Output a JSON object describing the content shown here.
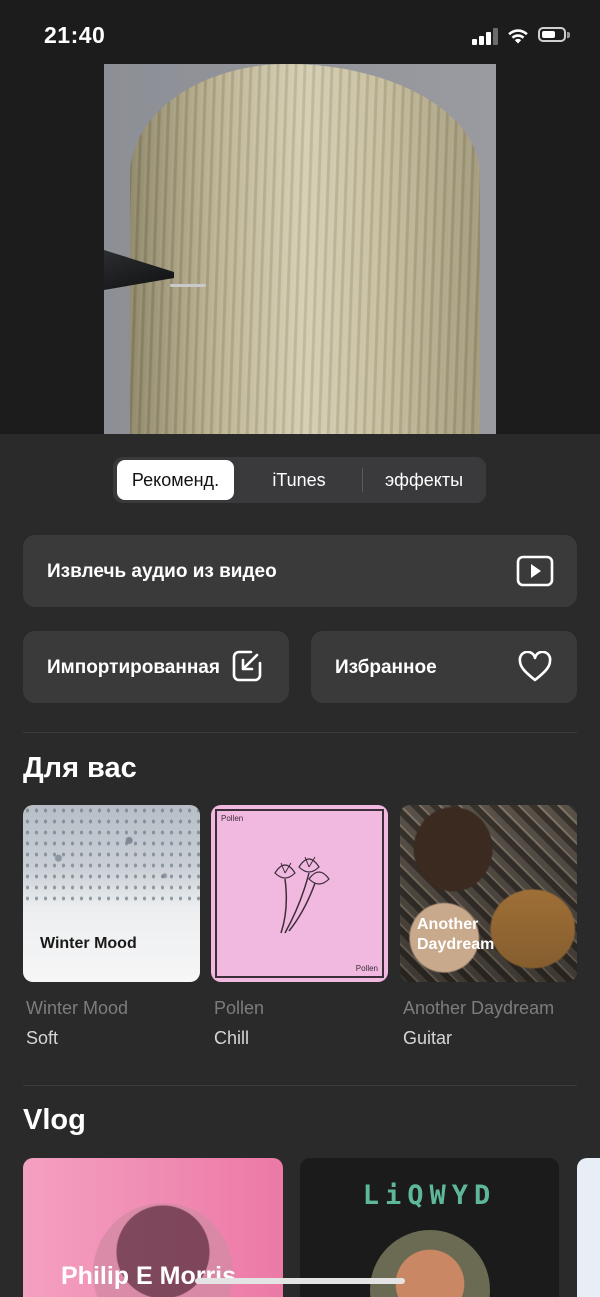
{
  "status_bar": {
    "time": "21:40"
  },
  "tabs": [
    {
      "label": "Рекоменд.",
      "active": true
    },
    {
      "label": "iTunes",
      "active": false
    },
    {
      "label": "эффекты",
      "active": false
    }
  ],
  "actions": {
    "extract_audio": {
      "label": "Извлечь аудио из видео",
      "icon": "play-rectangle-icon"
    },
    "imported": {
      "label": "Импортированная",
      "icon": "import-arrow-icon"
    },
    "favorites": {
      "label": "Избранное",
      "icon": "heart-icon"
    }
  },
  "sections": {
    "for_you": {
      "title": "Для вас",
      "playlists": [
        {
          "name": "Winter Mood",
          "genre": "Soft",
          "cover_text": "Winter Mood"
        },
        {
          "name": "Pollen",
          "genre": "Chill",
          "cover_text": "Pollen"
        },
        {
          "name": "Another Daydream",
          "genre": "Guitar",
          "cover_text": "Another Daydream"
        }
      ]
    },
    "vlog": {
      "title": "Vlog",
      "cards": [
        {
          "cover_text": "Philip E Morris"
        },
        {
          "cover_text": "LiQWYD"
        }
      ]
    }
  },
  "colors": {
    "background": "#2a2a2a",
    "card": "#3a3a3a",
    "accent_pink": "#f1b8e0",
    "logo_green": "#5fb79a"
  }
}
